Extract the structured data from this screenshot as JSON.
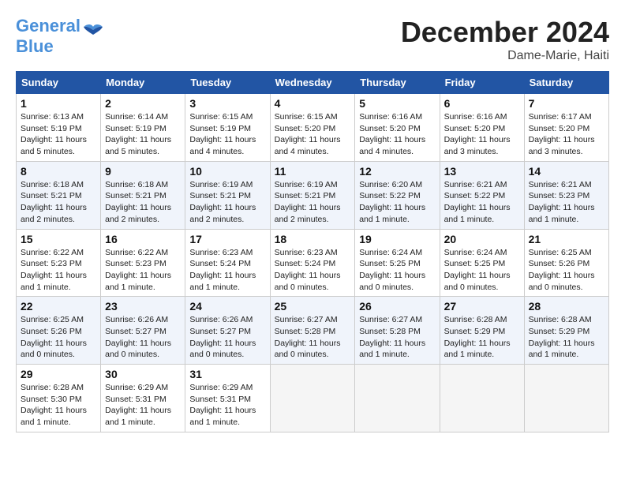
{
  "logo": {
    "line1": "General",
    "line2": "Blue"
  },
  "title": "December 2024",
  "subtitle": "Dame-Marie, Haiti",
  "weekdays": [
    "Sunday",
    "Monday",
    "Tuesday",
    "Wednesday",
    "Thursday",
    "Friday",
    "Saturday"
  ],
  "weeks": [
    [
      {
        "day": "1",
        "sunrise": "6:13 AM",
        "sunset": "5:19 PM",
        "daylight": "11 hours and 5 minutes."
      },
      {
        "day": "2",
        "sunrise": "6:14 AM",
        "sunset": "5:19 PM",
        "daylight": "11 hours and 5 minutes."
      },
      {
        "day": "3",
        "sunrise": "6:15 AM",
        "sunset": "5:19 PM",
        "daylight": "11 hours and 4 minutes."
      },
      {
        "day": "4",
        "sunrise": "6:15 AM",
        "sunset": "5:20 PM",
        "daylight": "11 hours and 4 minutes."
      },
      {
        "day": "5",
        "sunrise": "6:16 AM",
        "sunset": "5:20 PM",
        "daylight": "11 hours and 4 minutes."
      },
      {
        "day": "6",
        "sunrise": "6:16 AM",
        "sunset": "5:20 PM",
        "daylight": "11 hours and 3 minutes."
      },
      {
        "day": "7",
        "sunrise": "6:17 AM",
        "sunset": "5:20 PM",
        "daylight": "11 hours and 3 minutes."
      }
    ],
    [
      {
        "day": "8",
        "sunrise": "6:18 AM",
        "sunset": "5:21 PM",
        "daylight": "11 hours and 2 minutes."
      },
      {
        "day": "9",
        "sunrise": "6:18 AM",
        "sunset": "5:21 PM",
        "daylight": "11 hours and 2 minutes."
      },
      {
        "day": "10",
        "sunrise": "6:19 AM",
        "sunset": "5:21 PM",
        "daylight": "11 hours and 2 minutes."
      },
      {
        "day": "11",
        "sunrise": "6:19 AM",
        "sunset": "5:21 PM",
        "daylight": "11 hours and 2 minutes."
      },
      {
        "day": "12",
        "sunrise": "6:20 AM",
        "sunset": "5:22 PM",
        "daylight": "11 hours and 1 minute."
      },
      {
        "day": "13",
        "sunrise": "6:21 AM",
        "sunset": "5:22 PM",
        "daylight": "11 hours and 1 minute."
      },
      {
        "day": "14",
        "sunrise": "6:21 AM",
        "sunset": "5:23 PM",
        "daylight": "11 hours and 1 minute."
      }
    ],
    [
      {
        "day": "15",
        "sunrise": "6:22 AM",
        "sunset": "5:23 PM",
        "daylight": "11 hours and 1 minute."
      },
      {
        "day": "16",
        "sunrise": "6:22 AM",
        "sunset": "5:23 PM",
        "daylight": "11 hours and 1 minute."
      },
      {
        "day": "17",
        "sunrise": "6:23 AM",
        "sunset": "5:24 PM",
        "daylight": "11 hours and 1 minute."
      },
      {
        "day": "18",
        "sunrise": "6:23 AM",
        "sunset": "5:24 PM",
        "daylight": "11 hours and 0 minutes."
      },
      {
        "day": "19",
        "sunrise": "6:24 AM",
        "sunset": "5:25 PM",
        "daylight": "11 hours and 0 minutes."
      },
      {
        "day": "20",
        "sunrise": "6:24 AM",
        "sunset": "5:25 PM",
        "daylight": "11 hours and 0 minutes."
      },
      {
        "day": "21",
        "sunrise": "6:25 AM",
        "sunset": "5:26 PM",
        "daylight": "11 hours and 0 minutes."
      }
    ],
    [
      {
        "day": "22",
        "sunrise": "6:25 AM",
        "sunset": "5:26 PM",
        "daylight": "11 hours and 0 minutes."
      },
      {
        "day": "23",
        "sunrise": "6:26 AM",
        "sunset": "5:27 PM",
        "daylight": "11 hours and 0 minutes."
      },
      {
        "day": "24",
        "sunrise": "6:26 AM",
        "sunset": "5:27 PM",
        "daylight": "11 hours and 0 minutes."
      },
      {
        "day": "25",
        "sunrise": "6:27 AM",
        "sunset": "5:28 PM",
        "daylight": "11 hours and 0 minutes."
      },
      {
        "day": "26",
        "sunrise": "6:27 AM",
        "sunset": "5:28 PM",
        "daylight": "11 hours and 1 minute."
      },
      {
        "day": "27",
        "sunrise": "6:28 AM",
        "sunset": "5:29 PM",
        "daylight": "11 hours and 1 minute."
      },
      {
        "day": "28",
        "sunrise": "6:28 AM",
        "sunset": "5:29 PM",
        "daylight": "11 hours and 1 minute."
      }
    ],
    [
      {
        "day": "29",
        "sunrise": "6:28 AM",
        "sunset": "5:30 PM",
        "daylight": "11 hours and 1 minute."
      },
      {
        "day": "30",
        "sunrise": "6:29 AM",
        "sunset": "5:31 PM",
        "daylight": "11 hours and 1 minute."
      },
      {
        "day": "31",
        "sunrise": "6:29 AM",
        "sunset": "5:31 PM",
        "daylight": "11 hours and 1 minute."
      },
      null,
      null,
      null,
      null
    ]
  ]
}
